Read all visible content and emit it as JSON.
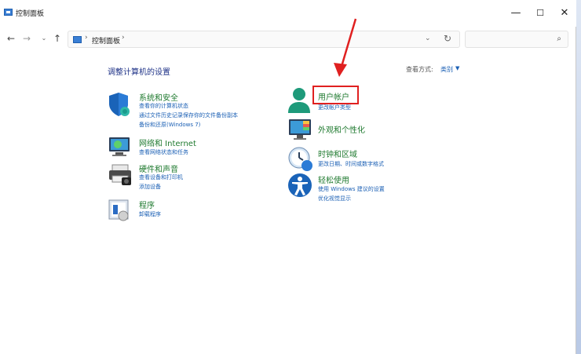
{
  "window": {
    "title": "控制面板",
    "controls": {
      "minimize": "—",
      "maximize": "☐",
      "close": "✕"
    }
  },
  "nav": {
    "back": "←",
    "forward": "→",
    "recent": "⌄",
    "up": "↑"
  },
  "address": {
    "separator": "›",
    "crumb": "控制面板",
    "dropdown": "⌄",
    "refresh": "↻"
  },
  "search": {
    "placeholder": "",
    "icon_glyph": "⌕"
  },
  "heading": "调整计算机的设置",
  "view_by": {
    "label": "查看方式:",
    "value": "类别",
    "caret": "▼"
  },
  "categories_left": [
    {
      "title": "系统和安全",
      "links": [
        "查看你的计算机状态",
        "通过文件历史记录保存你的文件备份副本",
        "备份和还原(Windows 7)"
      ],
      "icon": "shield-icon"
    },
    {
      "title": "网络和 Internet",
      "links": [
        "查看网络状态和任务"
      ],
      "icon": "network-icon"
    },
    {
      "title": "硬件和声音",
      "links": [
        "查看设备和打印机",
        "添加设备"
      ],
      "icon": "printer-icon"
    },
    {
      "title": "程序",
      "links": [
        "卸载程序"
      ],
      "icon": "programs-icon"
    }
  ],
  "categories_right": [
    {
      "title": "用户帐户",
      "links": [
        "更改帐户类型"
      ],
      "icon": "user-icon"
    },
    {
      "title": "外观和个性化",
      "links": [],
      "icon": "appearance-icon"
    },
    {
      "title": "时钟和区域",
      "links": [
        "更改日期、时间或数字格式"
      ],
      "icon": "clock-icon"
    },
    {
      "title": "轻松使用",
      "links": [
        "使用 Windows 建议的设置",
        "优化视觉显示"
      ],
      "icon": "accessibility-icon"
    }
  ],
  "colors": {
    "category_title": "#1f7a2f",
    "link": "#1a5fb4",
    "heading": "#1e3287",
    "annotation": "#e02020"
  }
}
